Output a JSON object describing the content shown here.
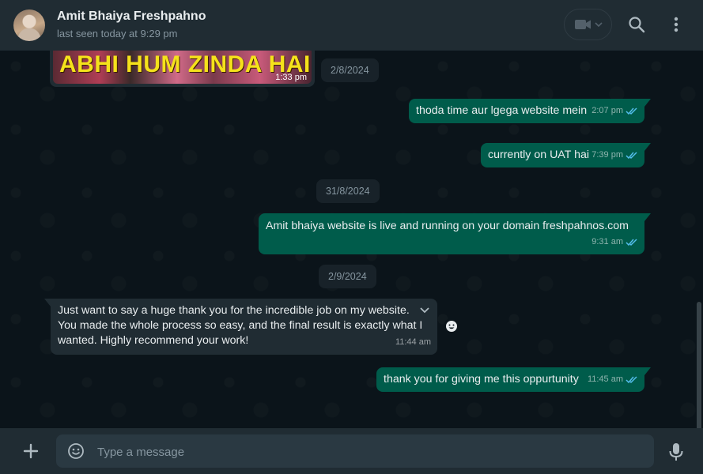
{
  "header": {
    "contact_name": "Amit Bhaiya Freshpahno",
    "last_seen": "last seen today at 9:29 pm"
  },
  "chat": {
    "media_message": {
      "caption": "ABHI HUM ZINDA HAI",
      "time": "1:33 pm"
    },
    "dates": [
      "2/8/2024",
      "31/8/2024",
      "2/9/2024"
    ],
    "messages": [
      {
        "text": "thoda time aur lgega website mein",
        "time": "2:07 pm",
        "status": "read"
      },
      {
        "text": "currently on UAT hai",
        "time": "7:39 pm",
        "status": "read"
      },
      {
        "text": "Amit bhaiya website is live and running on your domain freshpahnos.com",
        "time": "9:31 am",
        "status": "read"
      },
      {
        "text": "Just want to say a huge thank you for the incredible job on my website. You made the whole process so easy, and the final result is exactly what I wanted. Highly recommend your work!",
        "time": "11:44 am"
      },
      {
        "text": "thank you for giving me this oppurtunity",
        "time": "11:45 am",
        "status": "read"
      }
    ]
  },
  "composer": {
    "placeholder": "Type a message"
  },
  "colors": {
    "outgoing_bubble": "#005c4b",
    "incoming_bubble": "#202c33",
    "read_ticks": "#53bdeb",
    "background": "#0b141a"
  },
  "icons": [
    "video-call-icon",
    "search-icon",
    "menu-icon",
    "plus-icon",
    "emoji-icon",
    "mic-icon",
    "read-receipt-icon",
    "chevron-down-icon",
    "smiley-react-icon"
  ]
}
